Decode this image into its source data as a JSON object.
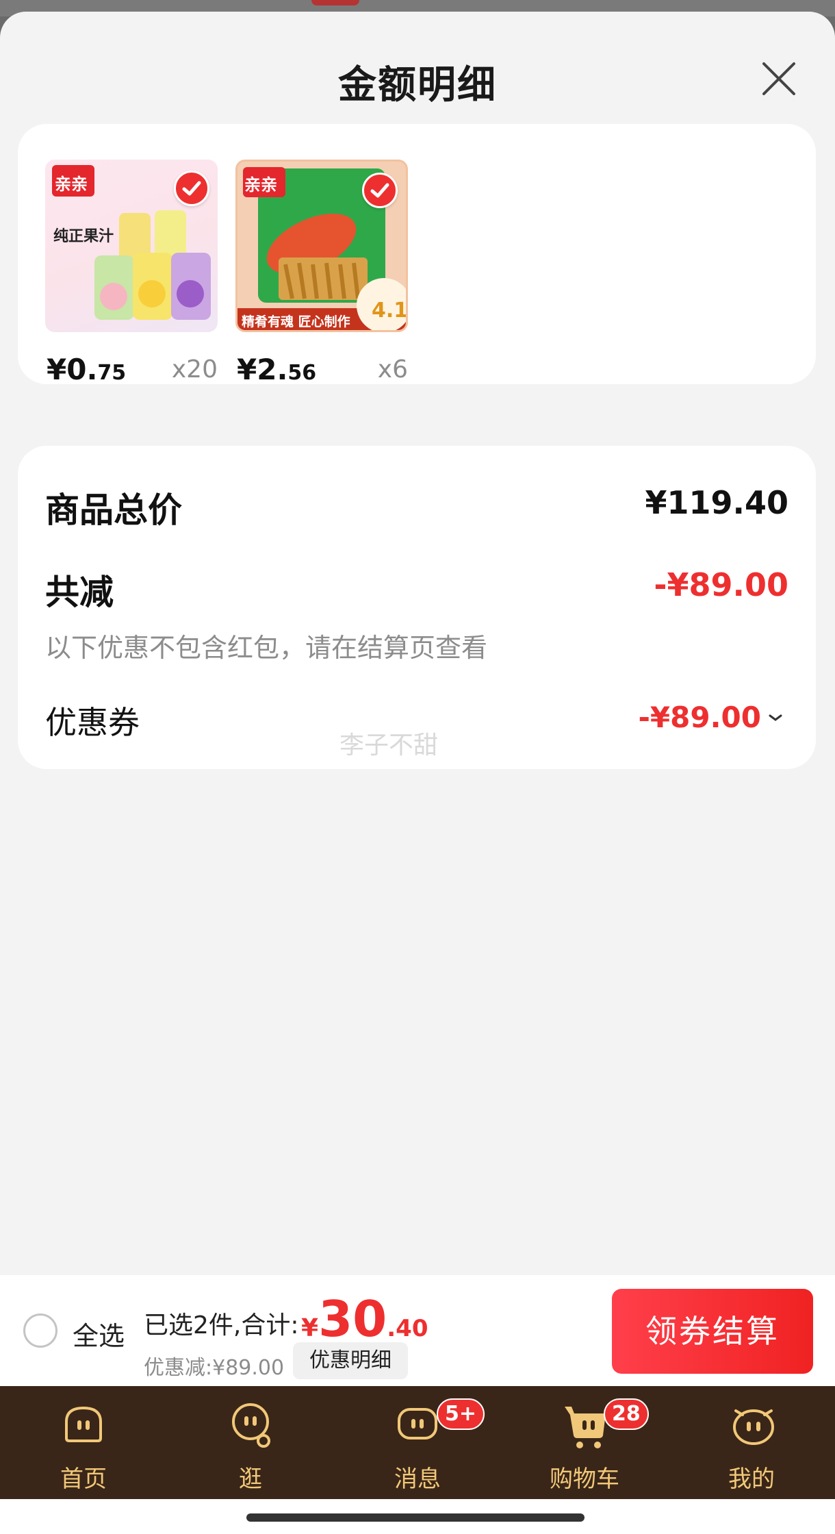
{
  "sheet": {
    "title": "金额明细"
  },
  "products": [
    {
      "price_int": "¥0.",
      "price_dec": "75",
      "qty": "x20",
      "brand": "亲亲",
      "caption": "纯正果汁"
    },
    {
      "price_int": "¥2.",
      "price_dec": "56",
      "qty": "x6",
      "brand": "亲亲",
      "caption": "精肴有魂 匠心制作",
      "badge": "4.1"
    }
  ],
  "summary": {
    "total_label": "商品总价",
    "total_value": "¥119.40",
    "reduce_label": "共减",
    "reduce_value": "-¥89.00",
    "note": "以下优惠不包含红包，请在结算页查看",
    "coupon_label": "优惠券",
    "coupon_value": "-¥89.00",
    "watermark": "李子不甜"
  },
  "bottom": {
    "select_all": "全选",
    "selected_text": "已选2件,合计:",
    "total_symbol": "¥",
    "total_int": "30",
    "total_dec": ".40",
    "discount": "优惠减:¥89.00",
    "detail_button": "优惠明细",
    "checkout_button": "领券结算"
  },
  "tabbar": {
    "tabs": [
      {
        "label": "首页",
        "icon": "home-icon"
      },
      {
        "label": "逛",
        "icon": "browse-icon"
      },
      {
        "label": "消息",
        "icon": "message-icon",
        "badge": "5+"
      },
      {
        "label": "购物车",
        "icon": "cart-icon",
        "badge": "28"
      },
      {
        "label": "我的",
        "icon": "profile-icon"
      }
    ]
  },
  "colors": {
    "accent": "#ee2f2f",
    "tab_bg": "#3a2618",
    "tab_text": "#f1c879"
  }
}
